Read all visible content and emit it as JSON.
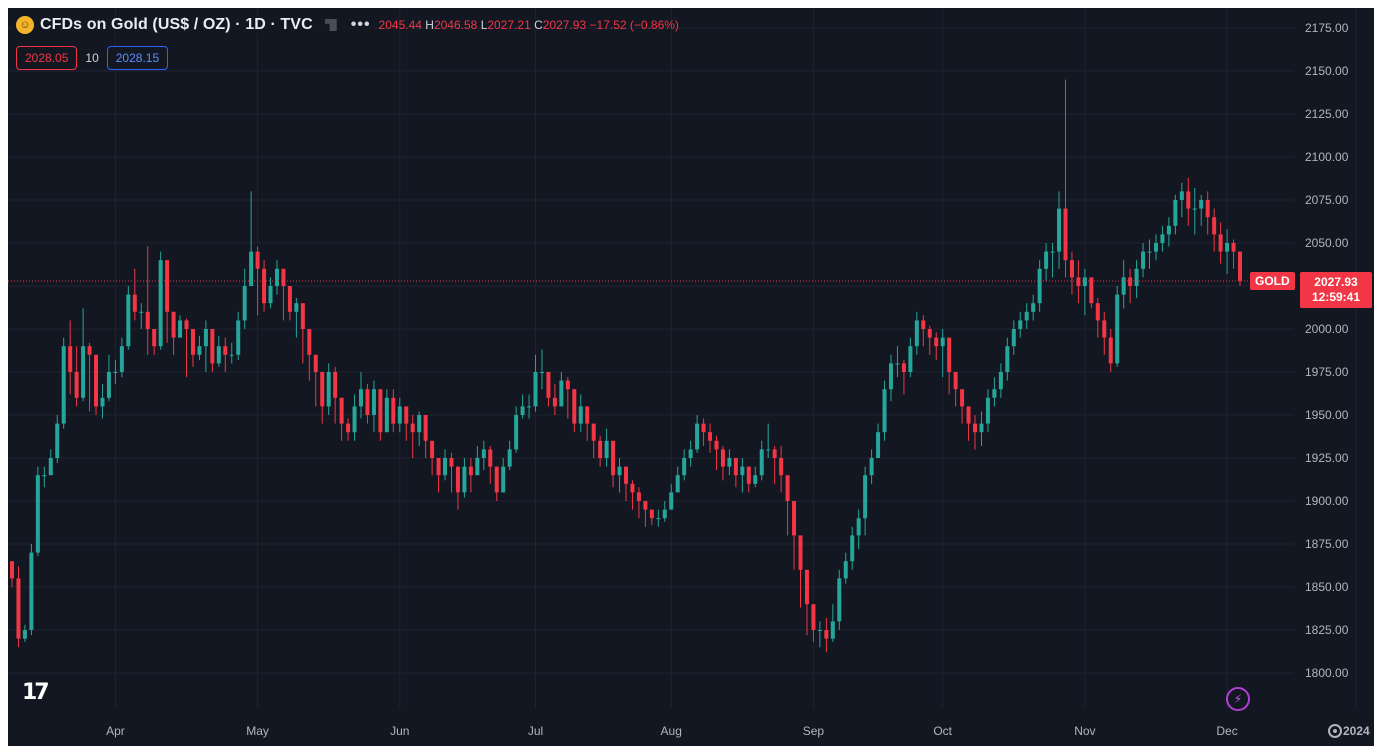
{
  "header": {
    "symbol_icon": "gold-coin-icon",
    "title": "CFDs on Gold (US$ / OZ) · 1D · TVC",
    "more": "•••",
    "ohlc": {
      "o": "2045.44",
      "h_key": "H",
      "h": "2046.58",
      "l_key": "L",
      "l": "2027.21",
      "c_key": "C",
      "c": "2027.93",
      "change": "−17.52 (−0.86%)"
    }
  },
  "quote": {
    "sell": "2028.05",
    "spread": "10",
    "buy": "2028.15"
  },
  "last_price": {
    "symbol": "GOLD",
    "value": "2027.93",
    "countdown": "12:59:41"
  },
  "colors": {
    "up": "#26a69a",
    "down": "#f23645",
    "background": "#131722",
    "grid": "#1f2330",
    "axis_text": "#b2b5be",
    "price_line": "#f23645"
  },
  "icons": {
    "logo": "tradingview-logo-icon",
    "bolt": "lightning-icon",
    "settings": "gear-icon"
  },
  "logo_text": "17",
  "bolt_glyph": "⚡",
  "chart_data": {
    "type": "candlestick",
    "y_ticks": [
      "2175.00",
      "2150.00",
      "2125.00",
      "2100.00",
      "2075.00",
      "2050.00",
      "2025.00",
      "2000.00",
      "1975.00",
      "1950.00",
      "1925.00",
      "1900.00",
      "1875.00",
      "1850.00",
      "1825.00",
      "1800.00"
    ],
    "ylim": [
      1785,
      2175
    ],
    "x_ticks": [
      {
        "label": "Apr",
        "index": 16
      },
      {
        "label": "May",
        "index": 38
      },
      {
        "label": "Jun",
        "index": 60
      },
      {
        "label": "Jul",
        "index": 81
      },
      {
        "label": "Aug",
        "index": 102
      },
      {
        "label": "Sep",
        "index": 124
      },
      {
        "label": "Oct",
        "index": 144
      },
      {
        "label": "Nov",
        "index": 166
      },
      {
        "label": "Dec",
        "index": 188
      },
      {
        "label": "2024",
        "index": 208
      }
    ],
    "last_close": 2027.93,
    "closes": [
      1855,
      1820,
      1825,
      1870,
      1915,
      1915,
      1925,
      1945,
      1990,
      1975,
      1960,
      1990,
      1985,
      1955,
      1960,
      1975,
      1975,
      1990,
      2020,
      2010,
      2010,
      2000,
      1990,
      2040,
      2010,
      1995,
      2005,
      2000,
      1985,
      1990,
      2000,
      1980,
      1990,
      1985,
      1985,
      2005,
      2025,
      2045,
      2035,
      2015,
      2025,
      2035,
      2025,
      2010,
      2015,
      2000,
      1985,
      1975,
      1955,
      1975,
      1960,
      1945,
      1940,
      1955,
      1965,
      1950,
      1965,
      1940,
      1960,
      1945,
      1955,
      1945,
      1940,
      1950,
      1935,
      1925,
      1915,
      1925,
      1920,
      1905,
      1920,
      1915,
      1925,
      1930,
      1920,
      1905,
      1920,
      1930,
      1950,
      1955,
      1955,
      1975,
      1975,
      1960,
      1955,
      1970,
      1965,
      1945,
      1955,
      1945,
      1935,
      1925,
      1935,
      1915,
      1920,
      1910,
      1905,
      1900,
      1895,
      1890,
      1890,
      1895,
      1905,
      1915,
      1925,
      1930,
      1945,
      1940,
      1935,
      1930,
      1920,
      1925,
      1915,
      1920,
      1910,
      1915,
      1930,
      1930,
      1925,
      1915,
      1900,
      1880,
      1860,
      1840,
      1825,
      1825,
      1820,
      1830,
      1855,
      1865,
      1880,
      1890,
      1915,
      1925,
      1940,
      1965,
      1980,
      1980,
      1975,
      1990,
      2005,
      2000,
      1995,
      1990,
      1995,
      1975,
      1965,
      1955,
      1945,
      1940,
      1945,
      1960,
      1965,
      1975,
      1990,
      2000,
      2005,
      2010,
      2015,
      2035,
      2045,
      2045,
      2070,
      2040,
      2030,
      2025,
      2030,
      2015,
      2005,
      1995,
      1980,
      2020,
      2030,
      2025,
      2035,
      2045,
      2045,
      2050,
      2055,
      2060,
      2075,
      2080,
      2070,
      2070,
      2075,
      2065,
      2055,
      2045,
      2050,
      2045,
      2028
    ],
    "highs": [
      1860,
      1862,
      1828,
      1875,
      1920,
      1920,
      1930,
      1950,
      1995,
      2005,
      1990,
      2012,
      1992,
      1982,
      1968,
      1985,
      1982,
      1995,
      2025,
      2035,
      2015,
      2048,
      1998,
      2045,
      2016,
      2002,
      2008,
      2006,
      1995,
      1996,
      2005,
      1990,
      1996,
      1995,
      1992,
      2010,
      2035,
      2080,
      2048,
      2040,
      2030,
      2040,
      2032,
      2022,
      2018,
      2010,
      1990,
      1985,
      1965,
      1980,
      1978,
      1955,
      1948,
      1962,
      1975,
      1968,
      1970,
      1960,
      1965,
      1965,
      1960,
      1955,
      1950,
      1952,
      1945,
      1935,
      1925,
      1930,
      1928,
      1918,
      1925,
      1925,
      1932,
      1935,
      1932,
      1920,
      1925,
      1935,
      1955,
      1962,
      1962,
      1985,
      1988,
      1975,
      1968,
      1975,
      1972,
      1962,
      1962,
      1955,
      1945,
      1938,
      1942,
      1932,
      1925,
      1918,
      1912,
      1908,
      1900,
      1895,
      1895,
      1900,
      1910,
      1920,
      1930,
      1935,
      1950,
      1948,
      1945,
      1938,
      1932,
      1930,
      1925,
      1925,
      1918,
      1920,
      1935,
      1945,
      1932,
      1932,
      1915,
      1895,
      1870,
      1845,
      1835,
      1830,
      1832,
      1840,
      1860,
      1870,
      1885,
      1895,
      1920,
      1930,
      1945,
      1970,
      1985,
      1990,
      1982,
      1995,
      2010,
      2008,
      2002,
      1998,
      2000,
      1990,
      1975,
      1965,
      1955,
      1950,
      1952,
      1965,
      1972,
      1980,
      1995,
      2005,
      2010,
      2015,
      2020,
      2040,
      2050,
      2050,
      2080,
      2145,
      2045,
      2040,
      2035,
      2030,
      2018,
      2010,
      2000,
      2025,
      2040,
      2035,
      2040,
      2050,
      2052,
      2055,
      2060,
      2065,
      2078,
      2085,
      2088,
      2082,
      2078,
      2080,
      2070,
      2062,
      2058,
      2052,
      2036
    ],
    "lows": [
      1850,
      1815,
      1818,
      1822,
      1868,
      1908,
      1915,
      1922,
      1942,
      1962,
      1955,
      1958,
      1952,
      1950,
      1948,
      1958,
      1968,
      1972,
      1988,
      2005,
      2000,
      1985,
      1985,
      1988,
      1992,
      1985,
      1995,
      1972,
      1978,
      1982,
      1975,
      1975,
      1978,
      1975,
      1980,
      1982,
      2000,
      2025,
      2008,
      2010,
      2012,
      2020,
      2005,
      2005,
      1995,
      1980,
      1970,
      1955,
      1945,
      1950,
      1945,
      1935,
      1935,
      1935,
      1948,
      1945,
      1940,
      1935,
      1940,
      1940,
      1940,
      1935,
      1925,
      1932,
      1925,
      1915,
      1905,
      1912,
      1905,
      1895,
      1902,
      1905,
      1915,
      1918,
      1910,
      1900,
      1905,
      1918,
      1928,
      1948,
      1948,
      1952,
      1965,
      1955,
      1950,
      1955,
      1948,
      1940,
      1940,
      1935,
      1925,
      1920,
      1920,
      1908,
      1905,
      1900,
      1895,
      1890,
      1885,
      1886,
      1885,
      1888,
      1895,
      1905,
      1912,
      1920,
      1928,
      1932,
      1928,
      1918,
      1912,
      1915,
      1908,
      1905,
      1905,
      1908,
      1912,
      1925,
      1910,
      1905,
      1880,
      1860,
      1838,
      1822,
      1818,
      1815,
      1812,
      1818,
      1825,
      1852,
      1860,
      1872,
      1880,
      1910,
      1925,
      1935,
      1958,
      1972,
      1962,
      1972,
      1985,
      1990,
      1985,
      1982,
      1972,
      1962,
      1955,
      1945,
      1935,
      1930,
      1932,
      1940,
      1955,
      1960,
      1970,
      1985,
      1995,
      2000,
      2005,
      2010,
      2028,
      2030,
      2035,
      2030,
      2020,
      2015,
      2008,
      2012,
      1995,
      1985,
      1975,
      1978,
      2012,
      2015,
      2018,
      2030,
      2035,
      2040,
      2045,
      2048,
      2055,
      2065,
      2060,
      2055,
      2060,
      2055,
      2045,
      2038,
      2032,
      2035,
      2025
    ]
  }
}
